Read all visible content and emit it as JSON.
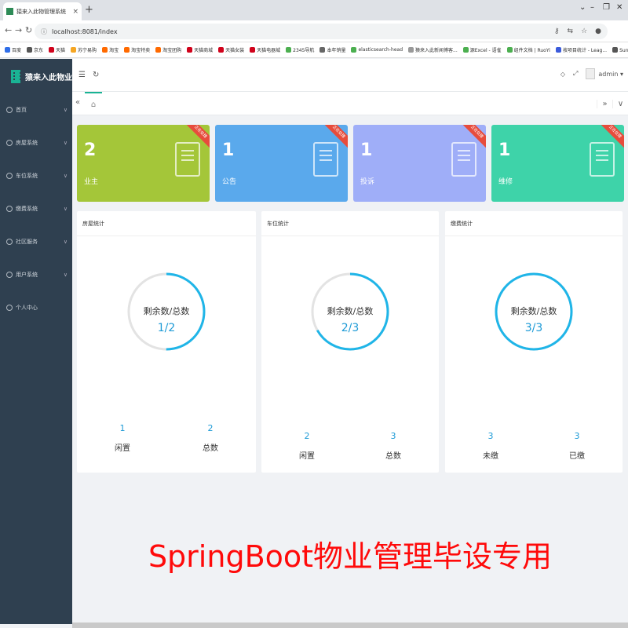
{
  "browser": {
    "tab_title": "猿来入此物管理系统",
    "tab_close": "×",
    "new_tab": "+",
    "controls": [
      "⌄",
      "–",
      "❐",
      "✕"
    ],
    "url": "localhost:8081/index",
    "bookmarks": [
      {
        "label": "百度",
        "color": "#2f6ee8"
      },
      {
        "label": "京东",
        "color": "#555555"
      },
      {
        "label": "天猫",
        "color": "#d0021b"
      },
      {
        "label": "苏宁易购",
        "color": "#f5a623"
      },
      {
        "label": "淘宝",
        "color": "#ff6a00"
      },
      {
        "label": "淘宝特卖",
        "color": "#ff6a00"
      },
      {
        "label": "淘宝团购",
        "color": "#ff6a00"
      },
      {
        "label": "天猫商城",
        "color": "#d0021b"
      },
      {
        "label": "天猫女装",
        "color": "#d0021b"
      },
      {
        "label": "天猫电器城",
        "color": "#d0021b"
      },
      {
        "label": "2345导航",
        "color": "#4caf50"
      },
      {
        "label": "本年销量",
        "color": "#666666"
      },
      {
        "label": "elasticsearch-head",
        "color": "#4caf50"
      },
      {
        "label": "猿来入此新闻博客...",
        "color": "#999999"
      },
      {
        "label": "源Excel - 语雀",
        "color": "#4caf50"
      },
      {
        "label": "组件文档 | RuoYi",
        "color": "#4caf50"
      },
      {
        "label": "按项目统计 - Leag...",
        "color": "#3b5bdb"
      },
      {
        "label": "Sunny-Ngrok内网...",
        "color": "#555555"
      }
    ]
  },
  "app": {
    "brand": "猿来入此物业",
    "menu": [
      {
        "label": "首页",
        "has_children": true
      },
      {
        "label": "房屋系统",
        "has_children": true
      },
      {
        "label": "车位系统",
        "has_children": true
      },
      {
        "label": "缴费系统",
        "has_children": true
      },
      {
        "label": "社区服务",
        "has_children": true
      },
      {
        "label": "用户系统",
        "has_children": true
      },
      {
        "label": "个人中心",
        "has_children": false
      }
    ],
    "user": "admin ▾",
    "cards": [
      {
        "value": "1",
        "label": "公告",
        "color": "#5aa9ec",
        "ribbon": "正在处理"
      },
      {
        "value": "2",
        "label": "业主",
        "color": "#a4c639",
        "ribbon": "正在处理"
      },
      {
        "value": "1",
        "label": "投诉",
        "color": "#9faef8",
        "ribbon": "正在处理"
      },
      {
        "value": "1",
        "label": "维修",
        "color": "#3ed3a9",
        "ribbon": "正在处理"
      }
    ],
    "panels": [
      {
        "title": "房屋统计",
        "center_label": "剩余数/总数",
        "center_value": "1/2",
        "fraction": 0.5,
        "stats": [
          {
            "value": "1",
            "label": "闲置"
          },
          {
            "value": "2",
            "label": "总数"
          }
        ]
      },
      {
        "title": "车位统计",
        "center_label": "剩余数/总数",
        "center_value": "2/3",
        "fraction": 0.6667,
        "stats": [
          {
            "value": "2",
            "label": "闲置"
          },
          {
            "value": "3",
            "label": "总数"
          }
        ]
      },
      {
        "title": "缴费统计",
        "center_label": "剩余数/总数",
        "center_value": "3/3",
        "fraction": 1.0,
        "stats": [
          {
            "value": "3",
            "label": "未缴"
          },
          {
            "value": "3",
            "label": "已缴"
          }
        ]
      }
    ],
    "ring_color": "#1fb5e8",
    "ring_track_color": "#e3e3e3"
  },
  "watermark": "SpringBoot物业管理毕设专用"
}
